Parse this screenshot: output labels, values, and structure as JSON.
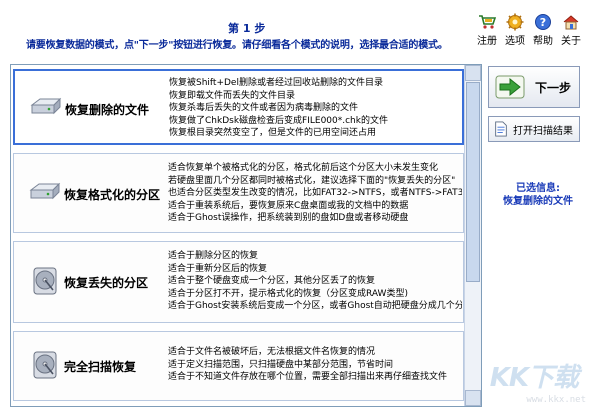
{
  "header": {
    "step_title": "第 1 步",
    "step_desc": "请要恢复数据的模式，点\"下一步\"按钮进行恢复。请仔细看各个模式的说明，选择最合适的模式。"
  },
  "toolbar": {
    "register": "注册",
    "options": "选项",
    "help": "帮助",
    "close": "关于"
  },
  "modes": [
    {
      "title": "恢复删除的文件",
      "icon": "hard-disk-icon",
      "lines": [
        "恢复被Shift+Del删除或者经过回收站删除的文件目录",
        "恢复即载文件而丢失的文件目录",
        "恢复杀毒后丢失的文件或者因为病毒删除的文件",
        "恢复做了ChkDsk磁盘检查后变成FILE000*.chk的文件",
        "恢复根目录突然变空了，但是文件的已用空间还占用"
      ]
    },
    {
      "title": "恢复格式化的分区",
      "icon": "hard-disk-icon",
      "lines": [
        "适合恢复单个被格式化的分区，格式化前后这个分区大小未发生变化",
        "若硬盘里面几个分区都同时被格式化，建议选择下面的\"恢复丢失的分区\"",
        "也适合分区类型发生改变的情况，比如FAT32->NTFS，或者NTFS->FAT3",
        "适合于重装系统后，要恢复原来C盘桌面或我的文档中的数据",
        "适合于Ghost误操作，把系统装到别的盘如D盘或者移动硬盘"
      ]
    },
    {
      "title": "恢复丢失的分区",
      "icon": "disk-platter-icon",
      "lines": [
        "适合于删除分区的恢复",
        "适合于重新分区后的恢复",
        "适合于整个硬盘变成一个分区，其他分区丢了的恢复",
        "适合于分区打不开，提示格式化的恢复（分区变成RAW类型)",
        "适合于Ghost安装系统后变成一个分区，或者Ghost自动把硬盘分成几个分"
      ]
    },
    {
      "title": "完全扫描恢复",
      "icon": "disk-platter-icon",
      "lines": [
        "适合于文件名被破坏后，无法根据文件名恢复的情况",
        "适于定义扫描范围，只扫描硬盘中某部分范围，节省时间",
        "适合于不知道文件存放在哪个位置，需要全部扫描出来再仔细查找文件"
      ]
    }
  ],
  "buttons": {
    "next": "下一步",
    "open_scan": "打开扫描结果"
  },
  "selection": {
    "label": "已选信息:",
    "value": "恢复删除的文件"
  },
  "watermark": {
    "text": "KK下载",
    "url": "www.kkx.net"
  },
  "colors": {
    "accent": "#3a6fd8",
    "title_blue": "#0a2a9a",
    "info_blue": "#1a3bb8"
  }
}
